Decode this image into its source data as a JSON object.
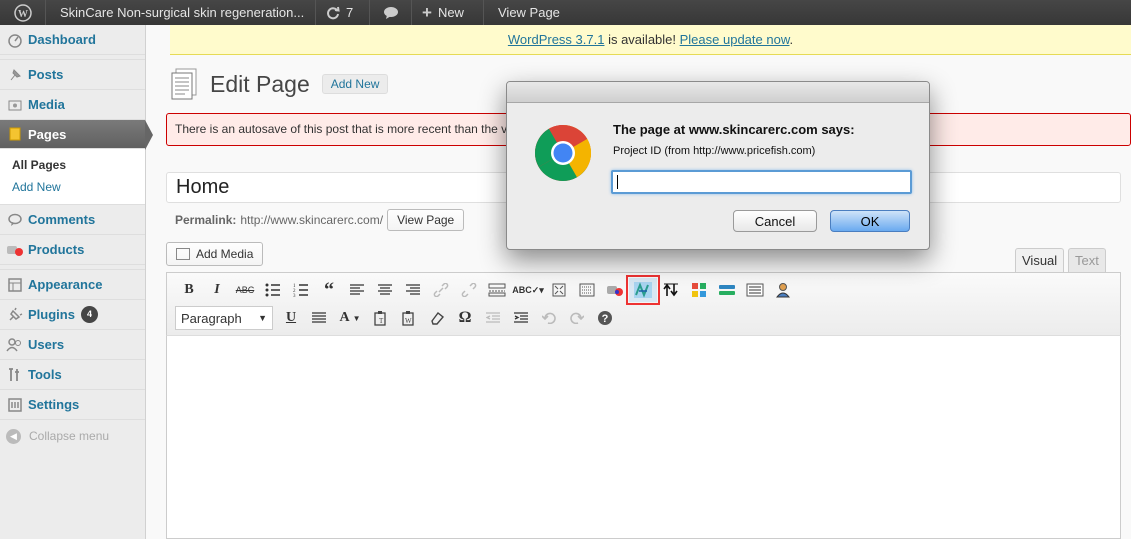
{
  "adminbar": {
    "site_title": "SkinCare Non-surgical skin regeneration...",
    "updates_count": "7",
    "new_label": "New",
    "view_page": "View Page"
  },
  "sidebar": {
    "items": [
      {
        "label": "Dashboard",
        "icon": "dashboard-icon"
      },
      {
        "label": "Posts",
        "icon": "pin-icon"
      },
      {
        "label": "Media",
        "icon": "media-icon"
      },
      {
        "label": "Pages",
        "icon": "pages-icon"
      },
      {
        "label": "Comments",
        "icon": "comment-icon"
      },
      {
        "label": "Products",
        "icon": "products-icon"
      },
      {
        "label": "Appearance",
        "icon": "appearance-icon"
      },
      {
        "label": "Plugins",
        "icon": "plugin-icon",
        "badge": "4"
      },
      {
        "label": "Users",
        "icon": "users-icon"
      },
      {
        "label": "Tools",
        "icon": "tools-icon"
      },
      {
        "label": "Settings",
        "icon": "settings-icon"
      }
    ],
    "submenu": [
      "All Pages",
      "Add New"
    ],
    "collapse": "Collapse menu"
  },
  "notice": {
    "link1": "WordPress 3.7.1",
    "text": " is available! ",
    "link2": "Please update now",
    "end": "."
  },
  "page": {
    "title": "Edit Page",
    "add_new": "Add New",
    "autosave": "There is an autosave of this post that is more recent than the v",
    "post_title": "Home",
    "permalink_label": "Permalink:",
    "permalink_url": "http://www.skincarerc.com/",
    "view_page_btn": "View Page",
    "add_media": "Add Media"
  },
  "editor": {
    "tab_visual": "Visual",
    "tab_text": "Text",
    "format_select": "Paragraph"
  },
  "dialog": {
    "title": "The page at www.skincarerc.com says:",
    "message": "Project ID (from http://www.pricefish.com)",
    "input_value": "",
    "cancel": "Cancel",
    "ok": "OK"
  }
}
